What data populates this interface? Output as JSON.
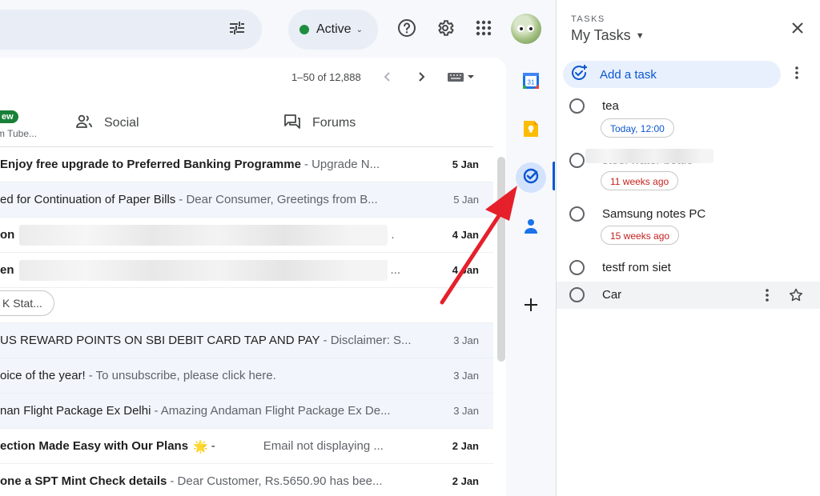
{
  "header": {
    "status_label": "Active",
    "icons": [
      "filter-icon",
      "help-icon",
      "settings-icon",
      "apps-grid-icon",
      "avatar"
    ]
  },
  "toolbar": {
    "pagination": "1–50 of 12,888",
    "icons": [
      "chevron-left-icon",
      "chevron-right-icon",
      "keyboard-icon"
    ]
  },
  "tabs": {
    "new_badge": "ew",
    "promotions_snippet": "m Tube...",
    "social_label": "Social",
    "forums_label": "Forums"
  },
  "emails": [
    {
      "subject": "Enjoy free upgrade to Preferred Banking Programme",
      "snippet": "- Upgrade N...",
      "date": "5 Jan",
      "unread": true
    },
    {
      "subject": "ed for Continuation of Paper Bills",
      "snippet": "- Dear Consumer, Greetings from B...",
      "date": "5 Jan",
      "unread": false
    },
    {
      "subject": "on",
      "snippet": ".",
      "date": "4 Jan",
      "unread": true
    },
    {
      "subject": "en",
      "snippet": "...",
      "date": "4 Jan",
      "unread": true
    },
    {
      "attachment_chip": "K Stat..."
    },
    {
      "subject": "US REWARD POINTS ON SBI DEBIT CARD TAP AND PAY",
      "snippet": "- Disclaimer: S...",
      "date": "3 Jan",
      "unread": false
    },
    {
      "subject": "oice of the year!",
      "snippet": "- To unsubscribe, please click here.",
      "date": "3 Jan",
      "unread": false
    },
    {
      "subject": "nan Flight Package Ex Delhi",
      "snippet": "- Amazing Andaman Flight Package Ex De...",
      "date": "3 Jan",
      "unread": false
    },
    {
      "subject": "ection Made Easy with Our Plans",
      "emoji": "🌟",
      "dash": "-",
      "snippet": "Email not displaying ...",
      "date": "2 Jan",
      "unread": true
    },
    {
      "subject": "one a SPT Mint Check details",
      "snippet": "- Dear Customer, Rs.5650.90 has bee...",
      "date": "2 Jan",
      "unread": true
    }
  ],
  "rail": {
    "calendar_day": "31",
    "icons": [
      "calendar-icon",
      "keep-icon",
      "tasks-icon",
      "contacts-icon",
      "add-icon"
    ]
  },
  "tasks_panel": {
    "eyebrow": "TASKS",
    "list_name": "My Tasks",
    "add_task_label": "Add a task",
    "items": [
      {
        "title": "tea",
        "due": "Today, 12:00",
        "due_color": "#0b57d0"
      },
      {
        "title": "steel water bottle",
        "due": "11 weeks ago",
        "due_color": "#c5221f"
      },
      {
        "title": "Samsung notes PC",
        "due": "15 weeks ago",
        "due_color": "#c5221f"
      },
      {
        "title": "testf rom siet"
      },
      {
        "title": "Car"
      }
    ]
  },
  "colors": {
    "accent": "#0b57d0",
    "status_green": "#1e8e3e",
    "overdue_red": "#c5221f",
    "arrow_red": "#e5202a"
  }
}
